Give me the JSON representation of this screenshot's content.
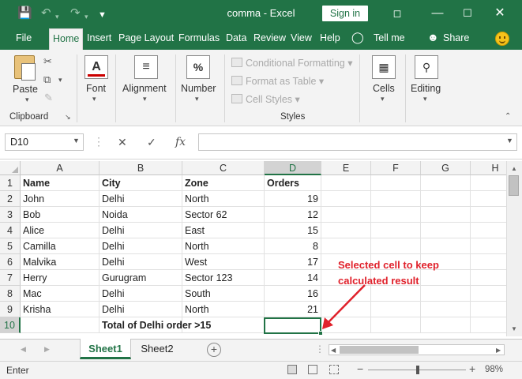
{
  "titlebar": {
    "title": "comma  -  Excel",
    "signin": "Sign in"
  },
  "menu": [
    "File",
    "Home",
    "Insert",
    "Page Layout",
    "Formulas",
    "Data",
    "Review",
    "View",
    "Help",
    "Tell me",
    "Share"
  ],
  "ribbon": {
    "paste": "Paste",
    "font": "Font",
    "alignment": "Alignment",
    "number": "Number",
    "conditional_formatting": "Conditional Formatting",
    "format_as_table": "Format as Table",
    "cell_styles": "Cell Styles",
    "cells": "Cells",
    "editing": "Editing",
    "group_clipboard": "Clipboard",
    "group_styles": "Styles"
  },
  "formula_bar": {
    "name_box": "D10",
    "formula": "",
    "fx": "fx"
  },
  "columns": [
    "A",
    "B",
    "C",
    "D",
    "E",
    "F",
    "G",
    "H"
  ],
  "rows": [
    [
      "Name",
      "City",
      "Zone",
      "Orders"
    ],
    [
      "John",
      "Delhi",
      "North",
      "19"
    ],
    [
      "Bob",
      "Noida",
      "Sector 62",
      "12"
    ],
    [
      "Alice",
      "Delhi",
      "East",
      "15"
    ],
    [
      "Camilla",
      "Delhi",
      "North",
      "8"
    ],
    [
      "Malvika",
      "Delhi",
      "West",
      "17"
    ],
    [
      "Herry",
      "Gurugram",
      "Sector 123",
      "14"
    ],
    [
      "Mac",
      "Delhi",
      "South",
      "16"
    ],
    [
      "Krisha",
      "Delhi",
      "North",
      "21"
    ],
    [
      "",
      "Total of Delhi order >15",
      "",
      ""
    ]
  ],
  "row_numbers": [
    "1",
    "2",
    "3",
    "4",
    "5",
    "6",
    "7",
    "8",
    "9",
    "10"
  ],
  "annotation": [
    "Selected cell to keep",
    "calculated result"
  ],
  "sheets": [
    "Sheet1",
    "Sheet2"
  ],
  "status": {
    "mode": "Enter",
    "zoom": "98%"
  },
  "colors": {
    "excel_green": "#217346",
    "annotation_red": "#e0212b"
  }
}
